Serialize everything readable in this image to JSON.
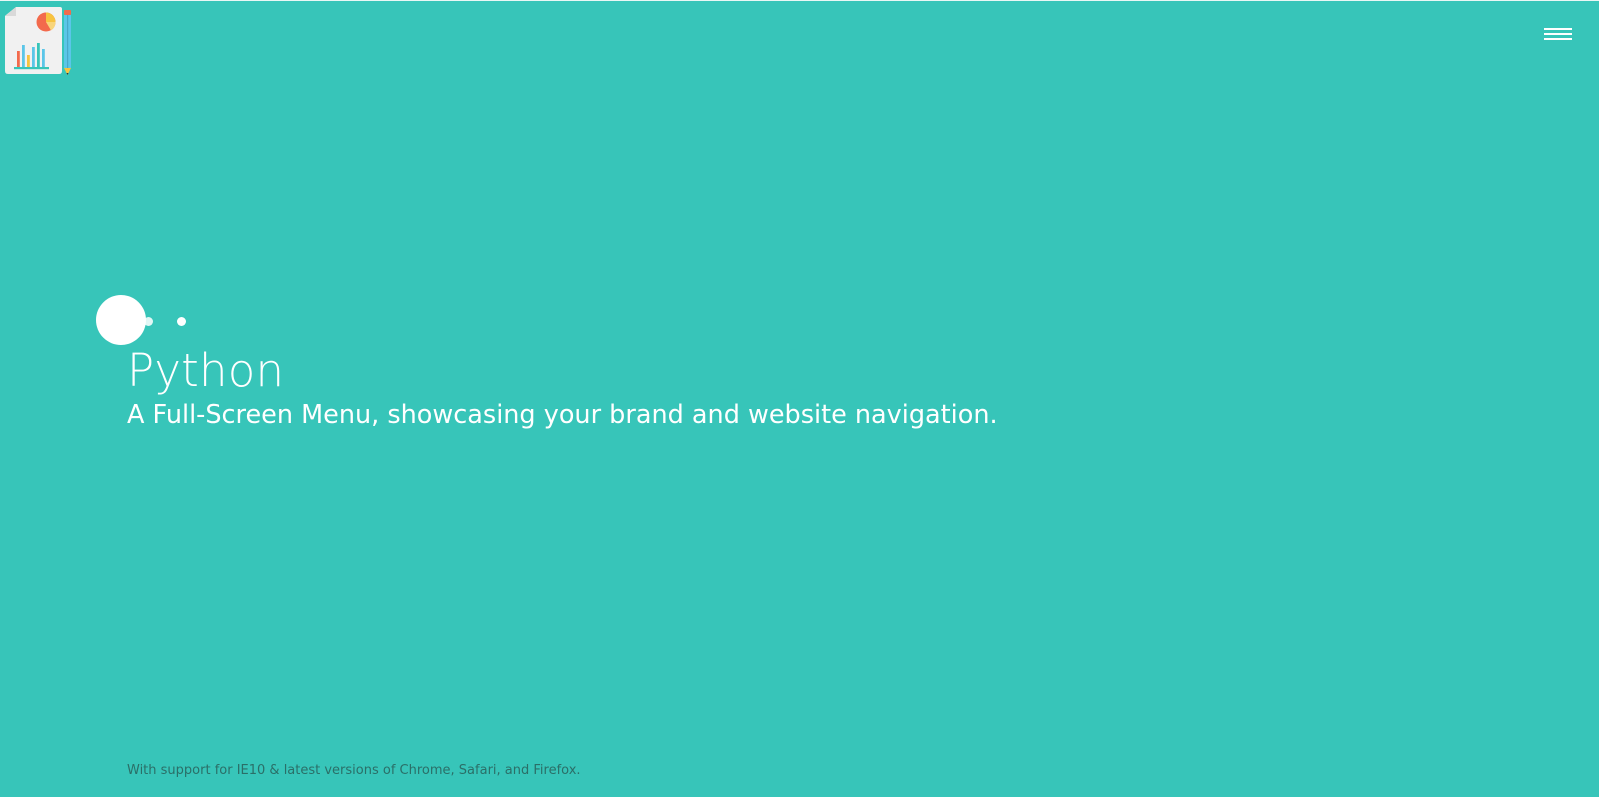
{
  "header": {
    "logo_icon": "report-chart-pencil-icon",
    "menu_icon": "hamburger-menu-icon"
  },
  "hero": {
    "title": "Python",
    "subtitle": "A Full-Screen Menu, showcasing your brand and website navigation."
  },
  "footer": {
    "note": "With support for IE10 & latest versions of Chrome, Safari, and Firefox."
  },
  "colors": {
    "background": "#37c5b9",
    "text": "#ffffff",
    "footer_text": "#2b6f68"
  }
}
